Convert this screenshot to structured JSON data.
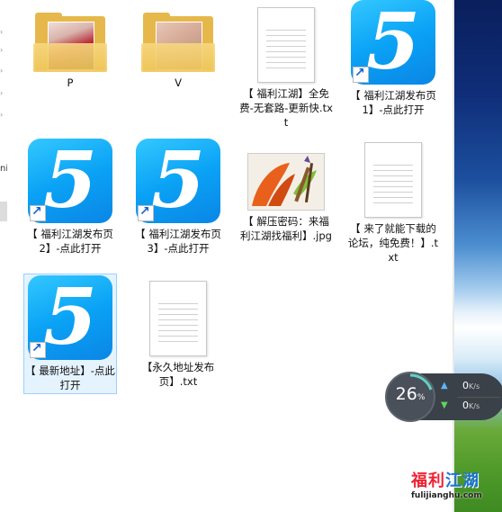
{
  "items": [
    {
      "label": "P"
    },
    {
      "label": "V"
    },
    {
      "label": "【 福利江湖】全免费-无套路-更新快.txt"
    },
    {
      "label": "【 福利江湖发布页1】-点此打开"
    },
    {
      "label": "【 福利江湖发布页2】-点此打开"
    },
    {
      "label": "【 福利江湖发布页3】-点此打开"
    },
    {
      "label": "【 解压密码：来福利江湖找福利】.jpg"
    },
    {
      "label": "【 来了就能下载的论坛，纯免费！】.txt"
    },
    {
      "label": "【 最新地址】-点此打开"
    },
    {
      "label": "【永久地址发布页】.txt"
    }
  ],
  "app_icon_glyph": "5",
  "network": {
    "percent": "26",
    "percent_unit": "%",
    "upload": "0",
    "download": "0",
    "rate_unit": "K/s"
  },
  "watermark": {
    "brand_red": "福利",
    "brand_blue": "江湖",
    "domain": "fulijianghu.com"
  },
  "left_panel_text": "ni",
  "colors": {
    "app_blue": "#0aa2f5",
    "selection": "#e5f3ff",
    "folder": "#e6b84b"
  }
}
